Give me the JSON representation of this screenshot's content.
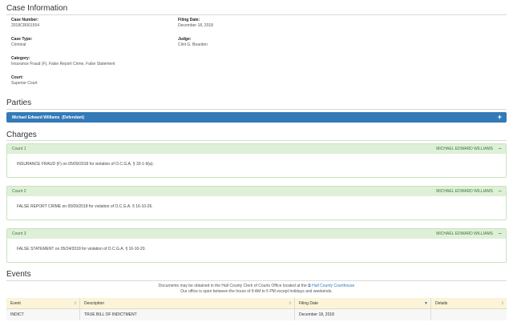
{
  "case_information": {
    "title": "Case Information",
    "case_number_label": "Case Number:",
    "case_number": "2018CR001554",
    "filing_date_label": "Filing Date:",
    "filing_date": "December 18, 2018",
    "case_type_label": "Case Type:",
    "case_type": "Criminal",
    "judge_label": "Judge:",
    "judge": "Clint G. Bearden",
    "category_label": "Category:",
    "category": "Insurance Fraud (F), False Report Crime, False Statement",
    "court_label": "Court:",
    "court": "Superior Court"
  },
  "parties": {
    "title": "Parties",
    "party_name": "Michael Edward Williams",
    "party_role": "(Defendant)",
    "expand_symbol": "+"
  },
  "charges": {
    "title": "Charges",
    "counts": [
      {
        "label": "Count 1",
        "defendant": "MICHAEL EDWARD WILLIAMS",
        "collapse_symbol": "−",
        "description": "INSURANCE FRAUD (F) on 05/09/2018 for violation of O.C.G.A. § 33-1-9(a)."
      },
      {
        "label": "Count 2",
        "defendant": "MICHAEL EDWARD WILLIAMS",
        "collapse_symbol": "−",
        "description": "FALSE REPORT CRIME on 05/09/2018 for violation of O.C.G.A. § 16-10-26."
      },
      {
        "label": "Count 3",
        "defendant": "MICHAEL EDWARD WILLIAMS",
        "collapse_symbol": "−",
        "description": "FALSE STATEMENT on 05/24/2018 for violation of O.C.G.A. § 16-10-20."
      }
    ]
  },
  "events": {
    "title": "Events",
    "notice_line1": "Documents may be obtained in the Hall County Clerk of Courts Office located at the",
    "notice_link": "Hall County Courthouse",
    "notice_line2": "Our office is open between the hours of 8 AM to 5 PM except holidays and weekends.",
    "columns": [
      "Event",
      "Description",
      "Filing Date",
      "Details"
    ],
    "rows": [
      {
        "event": "INDICT",
        "description": "TRUE BILL OF INDICTMENT",
        "filing_date": "December 18, 2018",
        "details": ""
      }
    ]
  }
}
